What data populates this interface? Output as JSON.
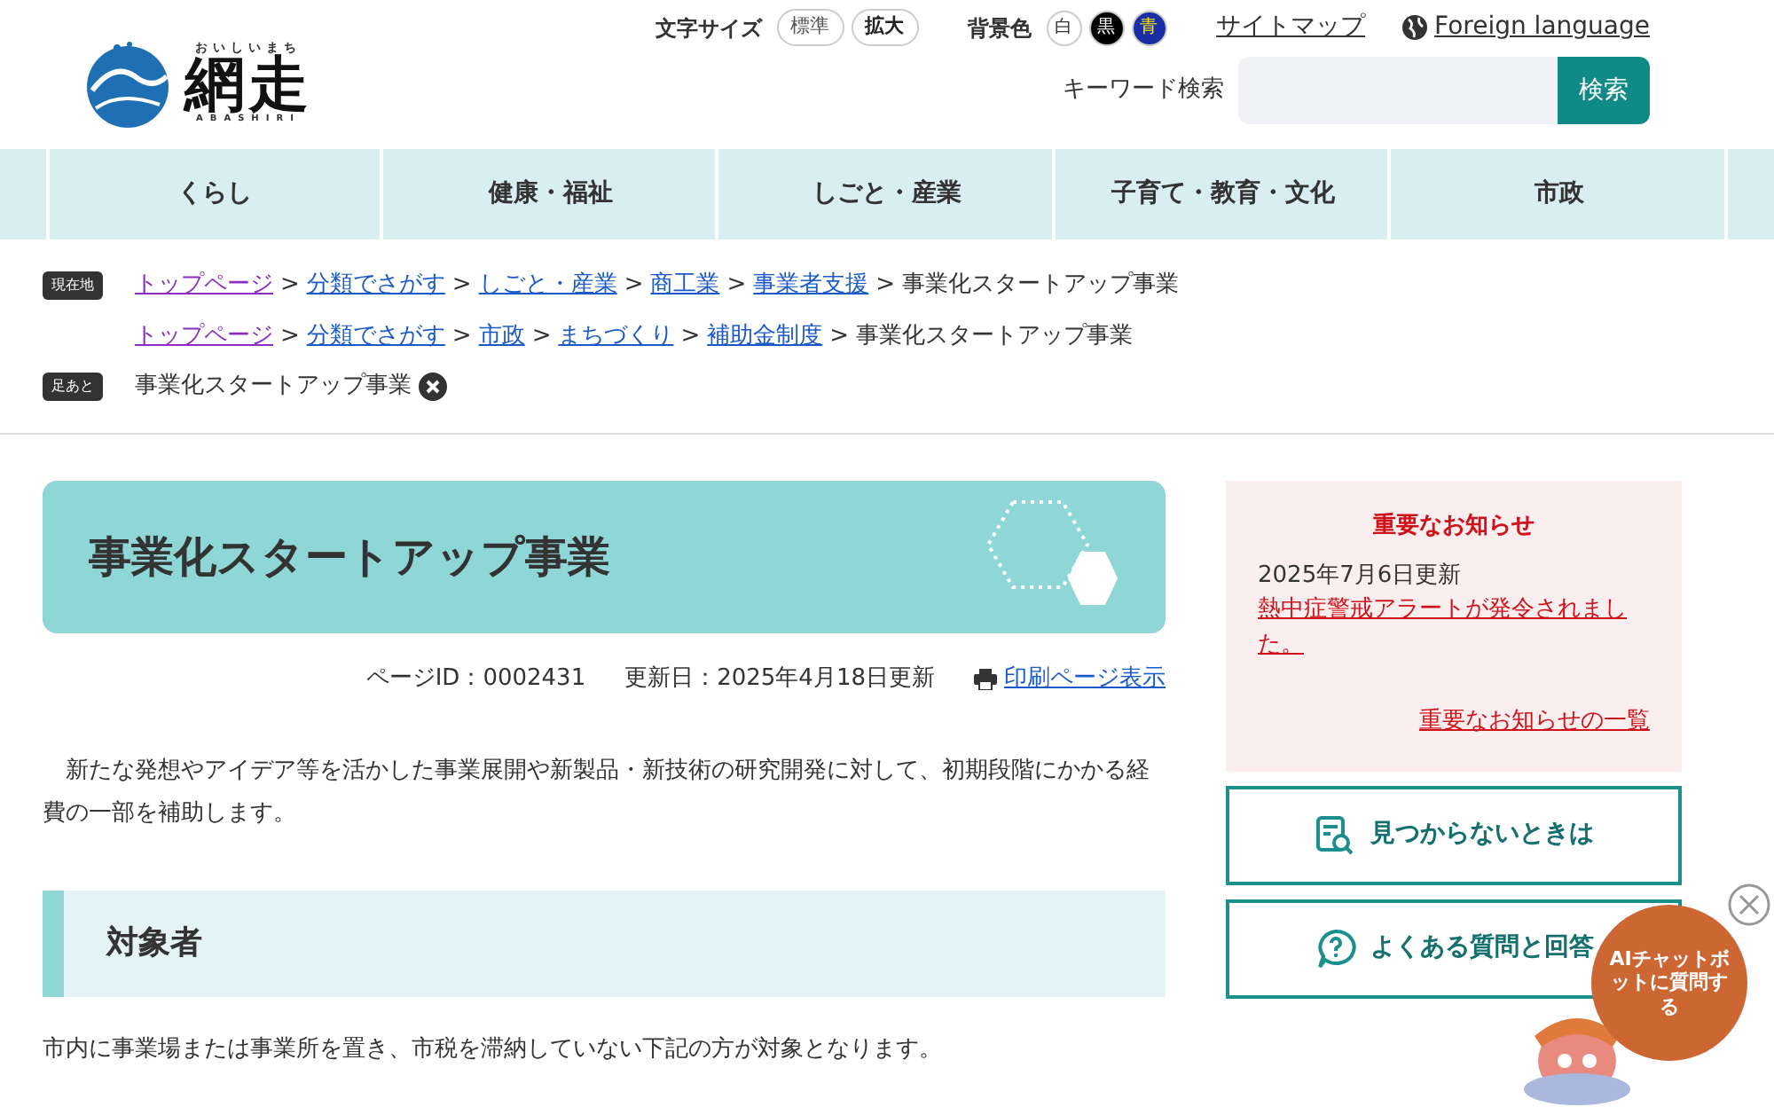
{
  "logo": {
    "furigana": "おいしいまち",
    "name": "網走",
    "romaji": "ABASHIRI"
  },
  "text_size": {
    "label": "文字サイズ",
    "options": [
      {
        "label": "標準",
        "selected": false
      },
      {
        "label": "拡大",
        "selected": true
      }
    ]
  },
  "background_color": {
    "label": "背景色",
    "options": [
      {
        "label": "白",
        "kind": "white",
        "color": "#ffffff"
      },
      {
        "label": "黒",
        "kind": "black",
        "color": "#000000"
      },
      {
        "label": "青",
        "kind": "blue",
        "color": "#1a2ea6"
      }
    ]
  },
  "links": [
    "サイトマップ",
    "Foreign language"
  ],
  "search": {
    "label": "キーワード検索",
    "button": "検索"
  },
  "nav": [
    "くらし",
    "健康・福祉",
    "しごと・産業",
    "子育て・教育・文化",
    "市政"
  ],
  "breadcrumbs": {
    "label": "現在地",
    "trails": [
      [
        {
          "text": "トップページ",
          "visited": true
        },
        {
          "text": "分類でさがす",
          "visited": false
        },
        {
          "text": "しごと・産業",
          "visited": false
        },
        {
          "text": "商工業",
          "visited": false
        },
        {
          "text": "事業者支援",
          "visited": false
        },
        {
          "text": "事業化スタートアップ事業",
          "current": true
        }
      ],
      [
        {
          "text": "トップページ",
          "visited": true
        },
        {
          "text": "分類でさがす",
          "visited": false
        },
        {
          "text": "市政",
          "visited": false
        },
        {
          "text": "まちづくり",
          "visited": false
        },
        {
          "text": "補助金制度",
          "visited": false
        },
        {
          "text": "事業化スタートアップ事業",
          "current": true
        }
      ]
    ],
    "separator": ">"
  },
  "footprints": {
    "label": "足あと",
    "items": [
      "事業化スタートアップ事業"
    ]
  },
  "page": {
    "title": "事業化スタートアップ事業",
    "page_id": "ページID：0002431",
    "updated": "更新日：2025年4月18日更新",
    "print": "印刷ページ表示",
    "intro": "新たな発想やアイデア等を活かした事業展開や新製品・新技術の研究開発に対して、初期段階にかかる経費の一部を補助します。",
    "section_heading": "対象者",
    "section_text": "市内に事業場または事業所を置き、市税を滞納していない下記の方が対象となります。"
  },
  "notice": {
    "title": "重要なお知らせ",
    "date": "2025年7月6日更新",
    "link": "熱中症警戒アラートが発令されました。",
    "more": "重要なお知らせの一覧"
  },
  "side_buttons": [
    {
      "kind": "search",
      "label": "見つからないときは"
    },
    {
      "kind": "faq",
      "label": "よくある質問と回答"
    }
  ],
  "chatbot": {
    "label": "AIチャットボットに質問する"
  }
}
